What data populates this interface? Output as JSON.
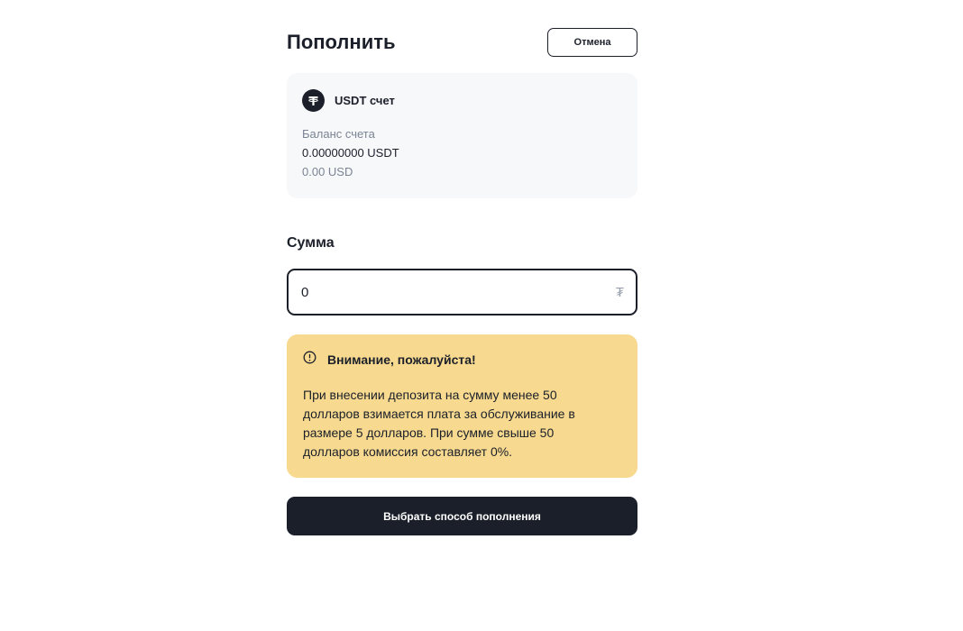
{
  "header": {
    "title": "Пополнить",
    "cancel_label": "Отмена"
  },
  "account": {
    "icon": "tether-icon",
    "name": "USDT счет",
    "balance_label": "Баланс счета",
    "balance_crypto": "0.00000000 USDT",
    "balance_fiat": "0.00 USD"
  },
  "amount": {
    "label": "Сумма",
    "value": "0",
    "currency_symbol": "₮"
  },
  "notice": {
    "icon": "info-circle-icon",
    "title": "Внимание, пожалуйста!",
    "text": "При внесении депозита на сумму менее 50 долларов взимается плата за обслуживание в размере 5 долларов. При сумме свыше 50 долларов комиссия составляет 0%."
  },
  "actions": {
    "submit_label": "Выбрать способ пополнения"
  },
  "colors": {
    "primary": "#1b1f2a",
    "card_bg": "#f7f8fa",
    "notice_bg": "#f7da8f",
    "muted_text": "#7b8494"
  }
}
